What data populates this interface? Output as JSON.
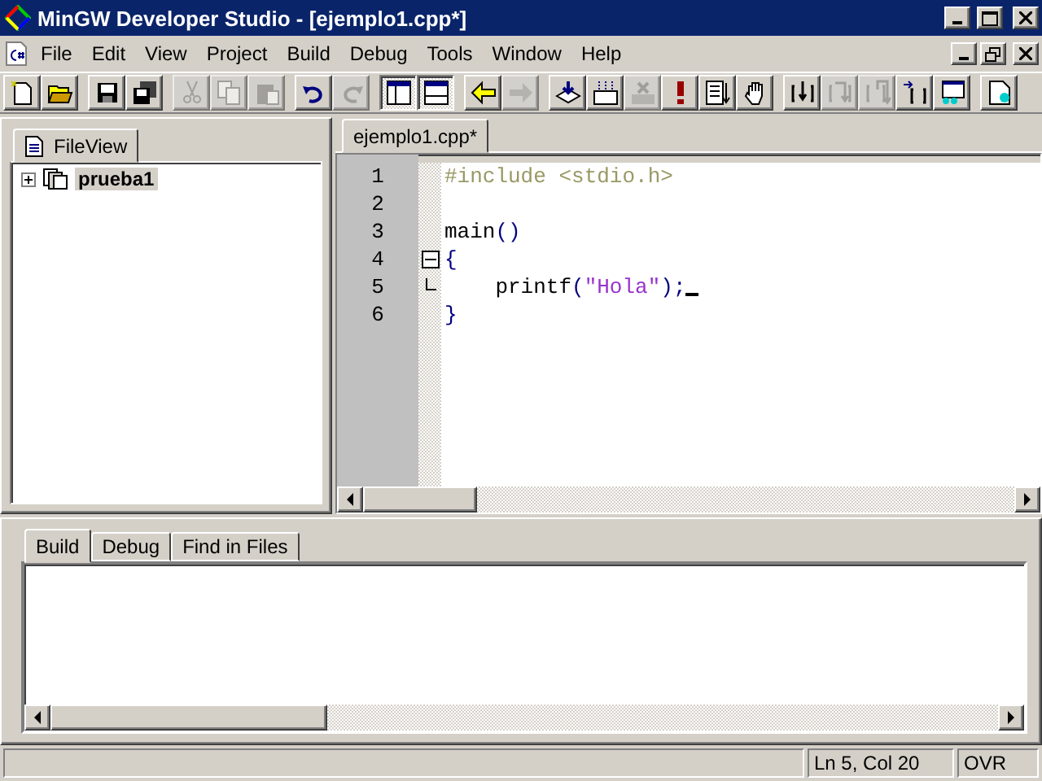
{
  "window": {
    "title": "MinGW Developer Studio - [ejemplo1.cpp*]"
  },
  "menu": [
    "File",
    "Edit",
    "View",
    "Project",
    "Build",
    "Debug",
    "Tools",
    "Window",
    "Help"
  ],
  "toolbar": [
    [
      {
        "kind": "new",
        "disabled": false,
        "pressed": false
      },
      {
        "kind": "open",
        "disabled": false,
        "pressed": false
      }
    ],
    [
      {
        "kind": "save",
        "disabled": false,
        "pressed": false
      },
      {
        "kind": "saveall",
        "disabled": false,
        "pressed": false
      }
    ],
    [
      {
        "kind": "cut",
        "disabled": true,
        "pressed": false
      },
      {
        "kind": "copy",
        "disabled": true,
        "pressed": false
      },
      {
        "kind": "paste",
        "disabled": true,
        "pressed": false
      }
    ],
    [
      {
        "kind": "undo",
        "disabled": false,
        "pressed": false
      },
      {
        "kind": "redo",
        "disabled": true,
        "pressed": false
      }
    ],
    [
      {
        "kind": "workspace",
        "disabled": false,
        "pressed": true
      },
      {
        "kind": "output",
        "disabled": false,
        "pressed": true
      }
    ],
    [
      {
        "kind": "back",
        "disabled": false,
        "pressed": false
      },
      {
        "kind": "forward",
        "disabled": true,
        "pressed": false
      }
    ],
    [
      {
        "kind": "compile",
        "disabled": false,
        "pressed": false
      },
      {
        "kind": "build",
        "disabled": false,
        "pressed": false
      },
      {
        "kind": "stop",
        "disabled": true,
        "pressed": false
      },
      {
        "kind": "execute",
        "disabled": false,
        "pressed": false
      },
      {
        "kind": "list",
        "disabled": false,
        "pressed": false
      },
      {
        "kind": "hand",
        "disabled": false,
        "pressed": false
      }
    ],
    [
      {
        "kind": "stepin",
        "disabled": false,
        "pressed": false
      },
      {
        "kind": "stepover",
        "disabled": true,
        "pressed": false
      },
      {
        "kind": "stepout",
        "disabled": true,
        "pressed": false
      },
      {
        "kind": "runcursor",
        "disabled": false,
        "pressed": false
      },
      {
        "kind": "watch",
        "disabled": false,
        "pressed": false
      }
    ],
    [
      {
        "kind": "doc",
        "disabled": false,
        "pressed": false
      }
    ]
  ],
  "workspace": {
    "tabs": [
      {
        "label": "FileView",
        "selected": true
      }
    ],
    "tree": [
      {
        "label": "prueba1",
        "selected": true,
        "expanded": false
      }
    ]
  },
  "editor": {
    "tabs": [
      {
        "label": "ejemplo1.cpp*",
        "selected": true
      }
    ],
    "lines": [
      {
        "number": "1",
        "tokens": [
          {
            "kind": "directive",
            "text": "#include <stdio.h>"
          }
        ]
      },
      {
        "number": "2"
      },
      {
        "number": "3",
        "tokens": [
          {
            "kind": "plain",
            "text": "main"
          },
          {
            "kind": "punct",
            "text": "()"
          }
        ]
      },
      {
        "number": "4",
        "fold_start": true,
        "tokens": [
          {
            "kind": "punct",
            "text": "{"
          }
        ]
      },
      {
        "number": "5",
        "fold_end": true,
        "cursor": true,
        "tokens": [
          {
            "kind": "plain",
            "text": "    printf"
          },
          {
            "kind": "punct",
            "text": "("
          },
          {
            "kind": "string",
            "text": "\"Hola\""
          },
          {
            "kind": "punct",
            "text": ");"
          }
        ]
      },
      {
        "number": "6",
        "tokens": [
          {
            "kind": "punct",
            "text": "}"
          }
        ]
      }
    ]
  },
  "output": {
    "tabs": [
      {
        "label": "Build",
        "selected": true
      },
      {
        "label": "Debug",
        "selected": false
      },
      {
        "label": "Find in Files",
        "selected": false
      }
    ]
  },
  "status_bar": {
    "position": "Ln 5, Col 20",
    "mode": "OVR"
  }
}
